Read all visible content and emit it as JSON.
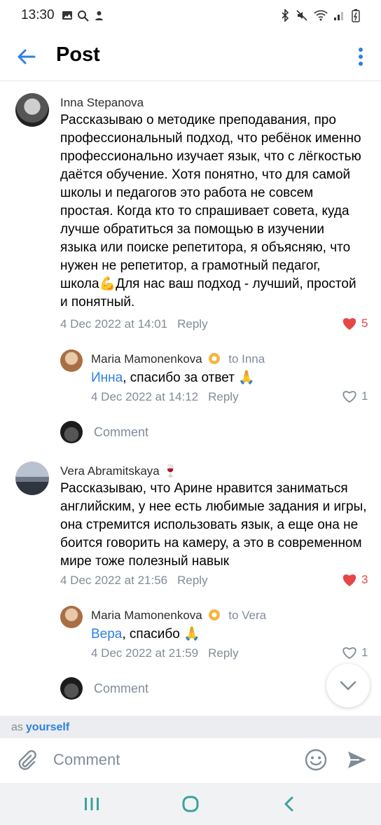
{
  "status_bar": {
    "time": "13:30"
  },
  "header": {
    "title": "Post"
  },
  "comments": [
    {
      "author": "Inna Stepanova",
      "text": "Рассказываю о методике преподавания, про профессиональный подход, что ребёнок именно профессионально изучает язык, что с лёгкостью даётся обучение. Хотя понятно, что для самой школы и педагогов это работа не совсем простая. Когда кто то спрашивает совета, куда лучше обратиться за помощью в изучении языка или поиске репетитора, я объясняю, что нужен не репетитор, а грамотный педагог, школа💪Для нас ваш подход - лучший, простой и понятный.",
      "date": "4 Dec 2022 at 14:01",
      "reply_label": "Reply",
      "likes": "5",
      "liked": true
    },
    {
      "author": "Maria Mamonenkova",
      "to": "to Inna",
      "mention": "Инна",
      "text": ", спасибо за ответ 🙏",
      "date": "4 Dec 2022 at 14:12",
      "reply_label": "Reply",
      "likes": "1",
      "liked": false
    },
    {
      "author": "Vera Abramitskaya 🍷",
      "text": "Рассказываю, что Арине нравится заниматься английским, у нее есть любимые задания и игры, она стремится использовать язык, а еще она не боится говорить на камеру, а это в современном мире тоже полезный навык",
      "date": "4 Dec 2022 at 21:56",
      "reply_label": "Reply",
      "likes": "3",
      "liked": true
    },
    {
      "author": "Maria Mamonenkova",
      "to": "to Vera",
      "mention": "Вера",
      "text": ", спасибо 🙏",
      "date": "4 Dec 2022 at 21:59",
      "reply_label": "Reply",
      "likes": "1",
      "liked": false
    }
  ],
  "thread_comment_placeholder": "Comment",
  "as_bar": {
    "prefix": "as",
    "identity": "yourself"
  },
  "composer": {
    "placeholder": "Comment"
  },
  "colors": {
    "accent": "#2d81e0",
    "like_red": "#e64646",
    "secondary_text": "#818c99"
  }
}
